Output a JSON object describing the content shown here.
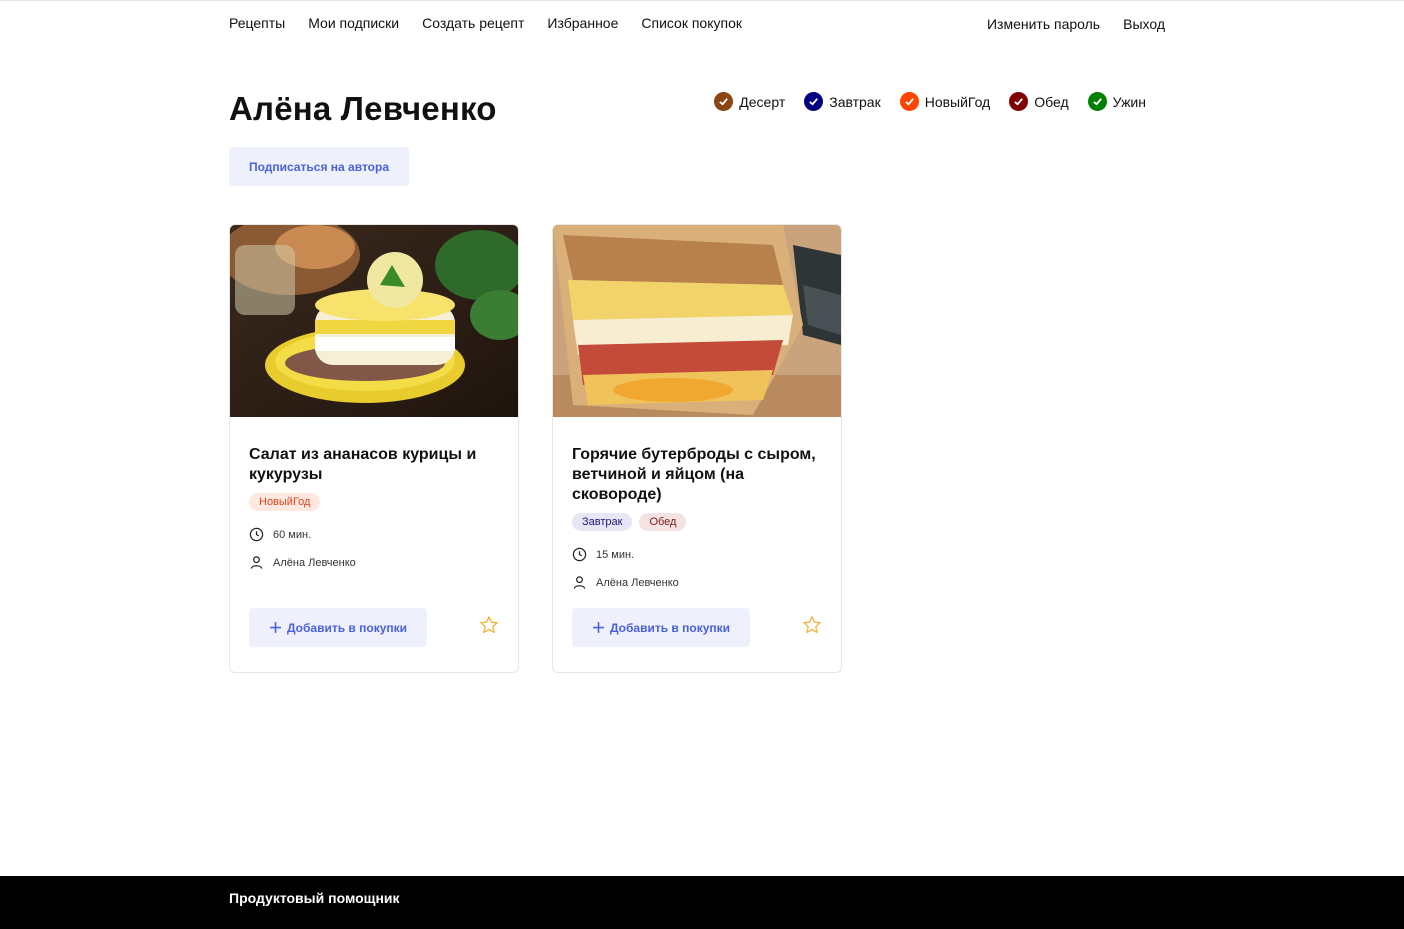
{
  "nav": {
    "left": [
      "Рецепты",
      "Мои подписки",
      "Создать рецепт",
      "Избранное",
      "Список покупок"
    ],
    "right": [
      "Изменить пароль",
      "Выход"
    ]
  },
  "author": {
    "name": "Алёна Левченко",
    "subscribe_label": "Подписаться на автора"
  },
  "tag_filters": [
    {
      "label": "Десерт",
      "color": "#8B4513"
    },
    {
      "label": "Завтрак",
      "color": "#000080"
    },
    {
      "label": "НовыйГод",
      "color": "#FF4500"
    },
    {
      "label": "Обед",
      "color": "#800000"
    },
    {
      "label": "Ужин",
      "color": "#008000"
    }
  ],
  "recipes": [
    {
      "title": "Салат из ананасов курицы и кукурузы",
      "tags": [
        {
          "label": "НовыйГод",
          "bg": "#ffe8e0",
          "color": "#e0431c"
        }
      ],
      "time": "60 мин.",
      "author": "Алёна Левченко",
      "add_label": "Добавить в покупки"
    },
    {
      "title": "Горячие бутерброды с сыром, ветчиной и яйцом (на сковороде)",
      "tags": [
        {
          "label": "Завтрак",
          "bg": "#e6e6f5",
          "color": "#1b1b7a"
        },
        {
          "label": "Обед",
          "bg": "#f5e3e3",
          "color": "#7a1b1b"
        }
      ],
      "time": "15 мин.",
      "author": "Алёна Левченко",
      "add_label": "Добавить в покупки"
    }
  ],
  "footer": {
    "text": "Продуктовый помощник"
  },
  "icons": {
    "clock": "clock-icon",
    "user": "user-icon",
    "star": "star-icon",
    "plus": "plus-icon",
    "check": "check-icon"
  },
  "colors": {
    "accent": "#4a61dd",
    "button_bg": "#eef0fb",
    "star": "#f0b43c",
    "footer_bg": "#000000"
  }
}
